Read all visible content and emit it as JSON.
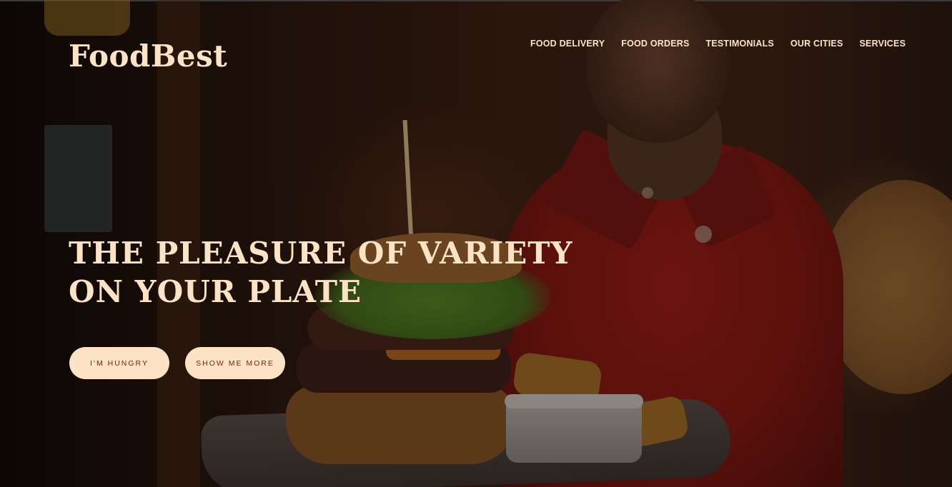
{
  "brand": {
    "logo": "FoodBest"
  },
  "nav": {
    "items": [
      {
        "label": "FOOD DELIVERY"
      },
      {
        "label": "FOOD ORDERS"
      },
      {
        "label": "TESTIMONIALS"
      },
      {
        "label": "OUR CITIES"
      },
      {
        "label": "SERVICES"
      }
    ]
  },
  "hero": {
    "headline_line1": "THE PLEASURE OF VARIETY",
    "headline_line2": "ON YOUR PLATE",
    "primary_button": "I'M HUNGRY",
    "secondary_button": "SHOW ME MORE"
  },
  "colors": {
    "accent": "#fde3c6",
    "button_text": "#7a1e14",
    "overlay": "#120a07"
  }
}
